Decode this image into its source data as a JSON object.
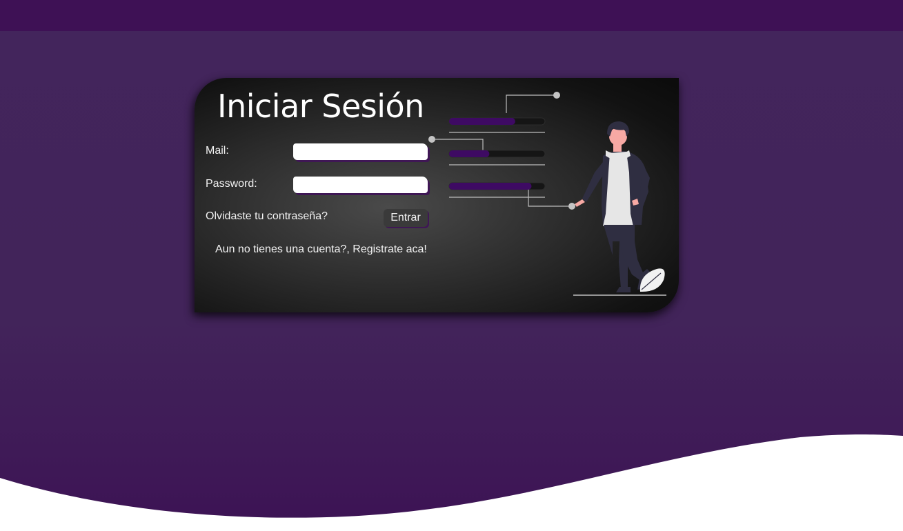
{
  "login": {
    "title": "Iniciar Sesión",
    "mail_label": "Mail:",
    "mail_value": "",
    "password_label": "Password:",
    "password_value": "",
    "forgot_password": "Olvidaste tu contraseña?",
    "submit_label": "Entrar",
    "register_link": "Aun no tienes una cuenta?, Registrate aca!"
  },
  "illustration": {
    "name": "person-with-progress-bars",
    "progress_levels": [
      0.69,
      0.42,
      0.86
    ],
    "colors": {
      "accent": "#3e0a63",
      "card": "#2b2b2b",
      "background": "#43255c",
      "header": "#3e1155"
    }
  }
}
